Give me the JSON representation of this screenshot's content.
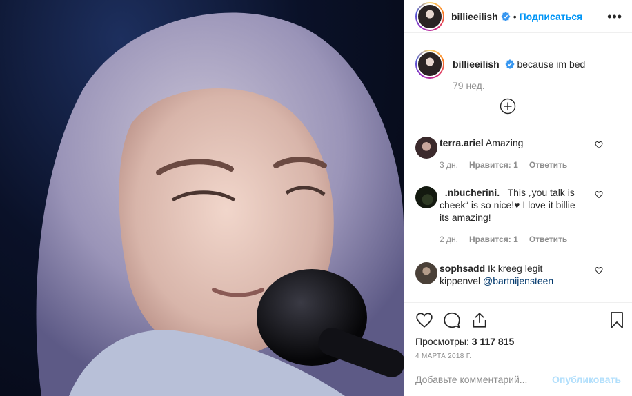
{
  "post": {
    "username": "billieeilish",
    "follow_label": "Подписаться",
    "caption": "because im bed",
    "caption_time": "79 нед.",
    "views_label": "Просмотры:",
    "views_count": "3 117 815",
    "date": "4 МАРТА 2018 Г."
  },
  "comments": [
    {
      "username": "terra.ariel",
      "text": "Amazing",
      "time": "3 дн.",
      "likes": "Нравится: 1",
      "reply": "Ответить"
    },
    {
      "username": "_.nbucherini._",
      "text": "This „you talk is cheek“ is so nice!♥ I love it billie its amazing!",
      "time": "2 дн.",
      "likes": "Нравится: 1",
      "reply": "Ответить"
    },
    {
      "username": "sophsadd",
      "text": "Ik kreeg legit kippenvel",
      "mention": "@bartnijensteen"
    }
  ],
  "composer": {
    "placeholder": "Добавьте комментарий...",
    "submit_label": "Опубликовать"
  },
  "colors": {
    "accent": "#0095f6",
    "muted": "#8e8e8e",
    "submit_disabled": "#b2dffc"
  }
}
